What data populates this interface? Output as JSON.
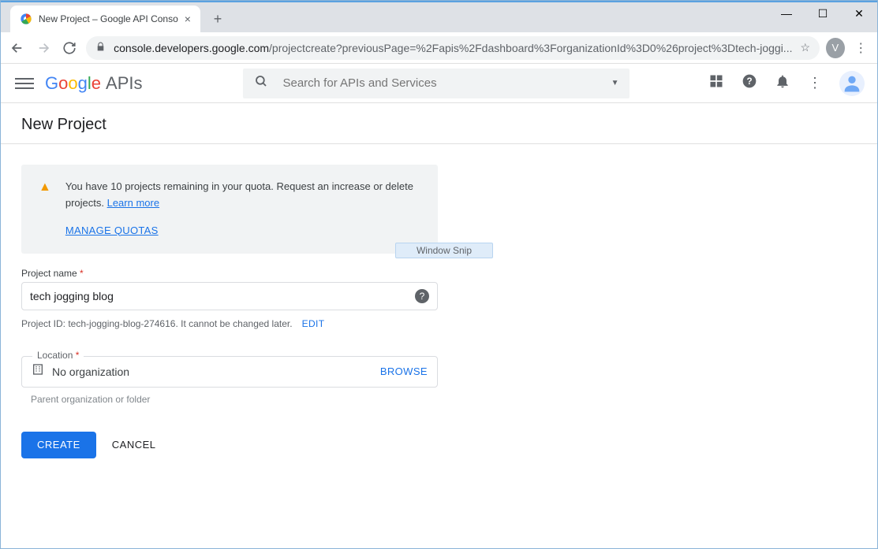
{
  "browser": {
    "tab_title": "New Project – Google API Conso",
    "url_host": "console.developers.google.com",
    "url_path": "/projectcreate?previousPage=%2Fapis%2Fdashboard%3ForganizationId%3D0%26project%3Dtech-joggi...",
    "avatar_letter": "V"
  },
  "header": {
    "logo_suffix": "APIs",
    "search_placeholder": "Search for APIs and Services"
  },
  "page": {
    "title": "New Project"
  },
  "quota": {
    "text_part1": "You have 10 projects remaining in your quota. Request an increase or delete projects. ",
    "learn_more": "Learn more",
    "manage": "MANAGE QUOTAS",
    "snip": "Window Snip"
  },
  "form": {
    "name_label": "Project name",
    "name_value": "tech jogging blog",
    "project_id_text": "Project ID: tech-jogging-blog-274616. It cannot be changed later.",
    "edit": "EDIT",
    "location_label": "Location",
    "location_value": "No organization",
    "browse": "BROWSE",
    "location_hint": "Parent organization or folder",
    "create": "CREATE",
    "cancel": "CANCEL"
  }
}
